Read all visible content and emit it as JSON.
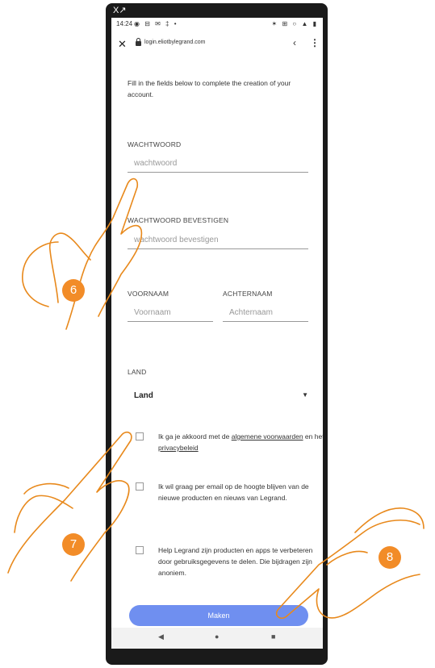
{
  "statusbar": {
    "time": "14:24",
    "left_icons": "◉ ⊟ ✉ ‡ •",
    "right_icons": "✶ ⊞ ○ ▲ ▮"
  },
  "urlbar": {
    "url": "login.eliotbylegrand.com",
    "close": "✕",
    "share": "‹",
    "menu": "⋮"
  },
  "window_marker": "X↗",
  "intro": "Fill in the fields below to complete the creation of your account.",
  "password": {
    "label": "WACHTWOORD",
    "placeholder": "wachtwoord"
  },
  "password_confirm": {
    "label": "WACHTWOORD BEVESTIGEN",
    "placeholder": "wachtwoord bevestigen"
  },
  "firstname": {
    "label": "VOORNAAM",
    "placeholder": "Voornaam"
  },
  "lastname": {
    "label": "ACHTERNAAM",
    "placeholder": "Achternaam"
  },
  "country": {
    "label": "LAND",
    "value": "Land",
    "caret": "▼"
  },
  "terms": {
    "prefix": "Ik ga je akkoord met de ",
    "link1": "algemene voorwaarden",
    "middle": " en het ",
    "link2": "privacybeleid"
  },
  "newsletter": {
    "text": "Ik wil graag per email op de hoogte blijven van de nieuwe producten en nieuws van Legrand."
  },
  "analytics": {
    "text": "Help Legrand zijn producten en apps te verbeteren door gebruiksgegevens te delen. Die bijdragen zijn anoniem."
  },
  "submit": {
    "label": "Maken"
  },
  "navbar": {
    "back": "◀",
    "home": "●",
    "recent": "■"
  },
  "callouts": [
    "6",
    "7",
    "8"
  ],
  "colors": {
    "accent": "#6f8ff0",
    "callout": "#f28c28",
    "hand_outline": "#e8891c"
  }
}
